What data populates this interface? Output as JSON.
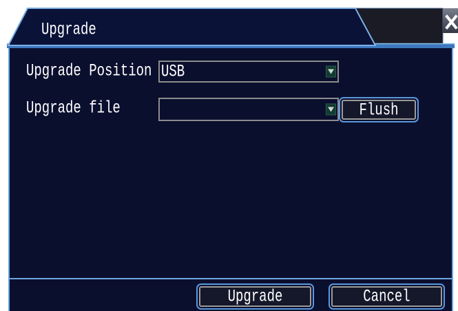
{
  "window": {
    "title": "Upgrade",
    "close_icon": "close-icon"
  },
  "form": {
    "position": {
      "label": "Upgrade Position",
      "value": "USB",
      "dropdown_icon": "chevron-down-icon"
    },
    "file": {
      "label": "Upgrade file",
      "value": "",
      "dropdown_icon": "chevron-down-icon"
    },
    "flush_label": "Flush"
  },
  "footer": {
    "upgrade_label": "Upgrade",
    "cancel_label": "Cancel"
  },
  "colors": {
    "panel": "#0b0f2e",
    "accent": "#6ea6e0",
    "text": "#ffffff",
    "field_border": "#8d8d8d"
  }
}
